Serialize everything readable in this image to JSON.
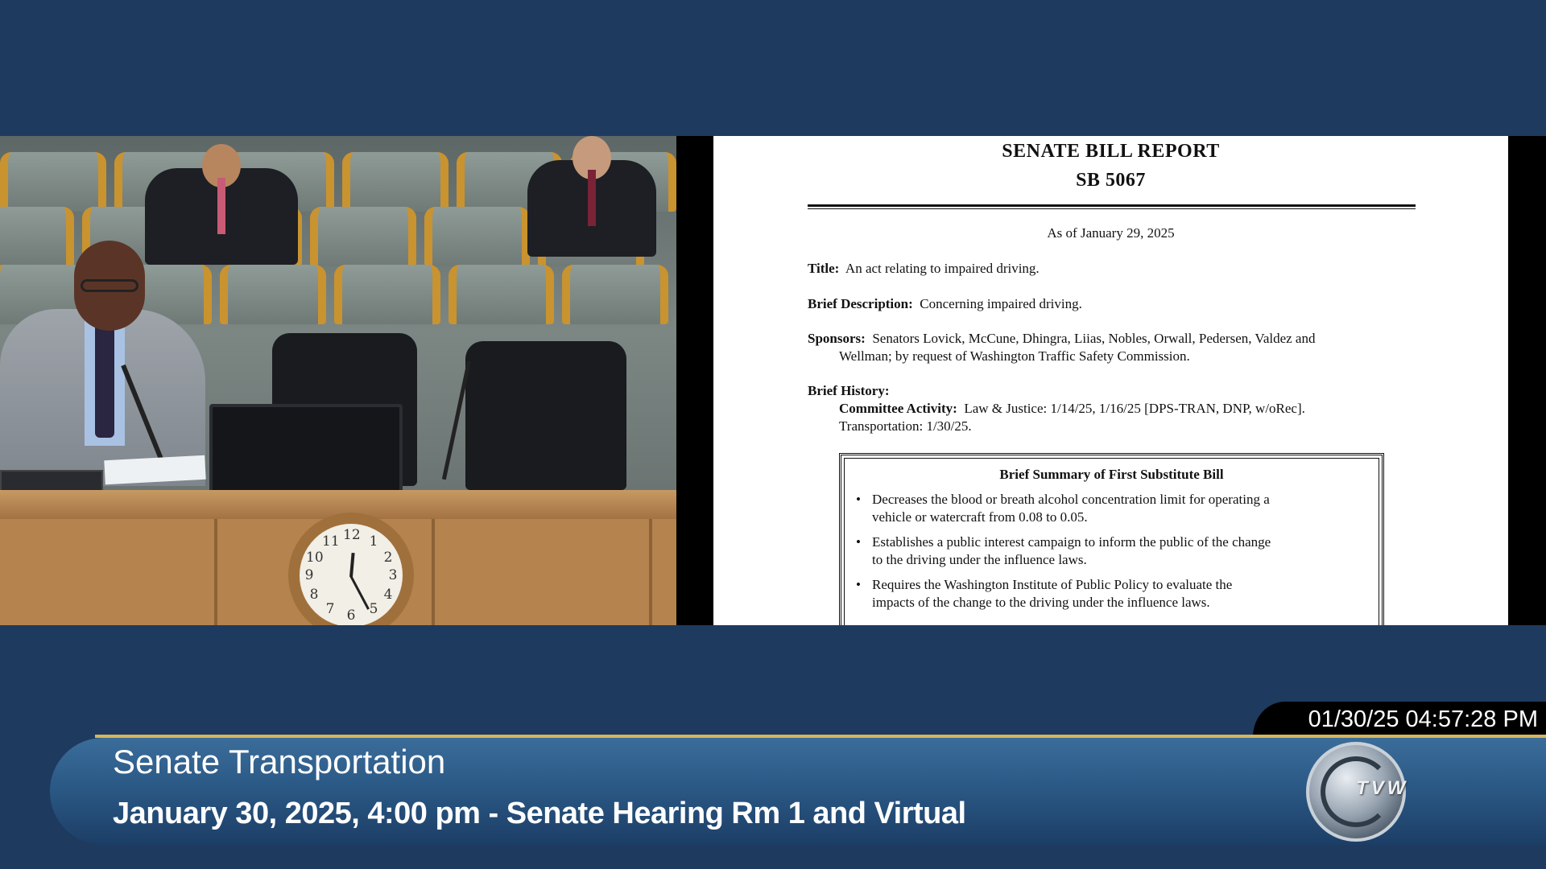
{
  "document": {
    "title_line1": "SENATE BILL REPORT",
    "title_line2": "SB 5067",
    "as_of": "As of January 29, 2025",
    "title_label": "Title:",
    "title_text": "An act relating to impaired driving.",
    "brief_description_label": "Brief Description:",
    "brief_description_text": "Concerning impaired driving.",
    "sponsors_label": "Sponsors:",
    "sponsors_line1": "Senators Lovick, McCune, Dhingra, Liias, Nobles, Orwall, Pedersen, Valdez and",
    "sponsors_line2": "Wellman; by request of Washington Traffic Safety Commission.",
    "brief_history_label": "Brief History:",
    "committee_activity_label": "Committee Activity:",
    "committee_activity_line1": "Law & Justice: 1/14/25, 1/16/25 [DPS-TRAN, DNP, w/oRec].",
    "committee_activity_line2": "Transportation: 1/30/25.",
    "summary": {
      "title": "Brief Summary of First Substitute Bill",
      "bullets": [
        {
          "line1": "Decreases the blood or breath alcohol concentration limit for operating a",
          "line2": "vehicle or watercraft from 0.08 to 0.05."
        },
        {
          "line1": "Establishes a public interest campaign to inform the public of the change",
          "line2": "to the driving under the influence laws."
        },
        {
          "line1": "Requires the Washington Institute of Public Policy to evaluate the",
          "line2": "impacts of the change to the driving under the influence laws."
        }
      ]
    }
  },
  "lower_third": {
    "timestamp": "01/30/25 04:57:28 PM",
    "committee": "Senate Transportation",
    "session_info": "January 30, 2025, 4:00 pm - Senate Hearing Rm 1 and Virtual",
    "logo_text": "TVW"
  },
  "clock": {
    "numbers": [
      "12",
      "1",
      "2",
      "3",
      "4",
      "5",
      "6",
      "7",
      "8",
      "9",
      "10",
      "11"
    ]
  },
  "colors": {
    "background": "#1f3a5f",
    "gold_rule": "#d7b55c",
    "banner": "#2b5986"
  }
}
